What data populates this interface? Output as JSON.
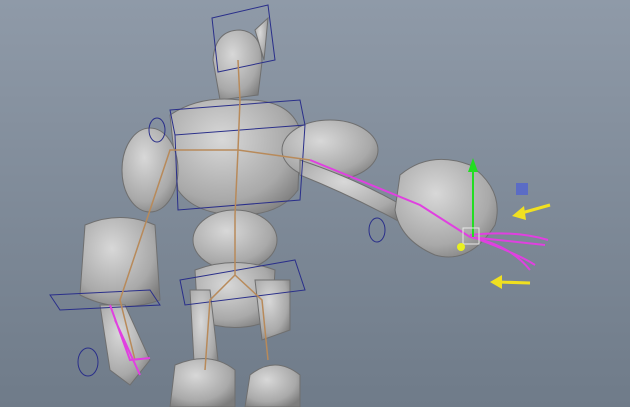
{
  "viewport": {
    "background_top": "#8f9aa8",
    "background_bottom": "#6f7b89",
    "mesh_color": "#c8c8c8",
    "mesh_shadow": "#8e8e8e",
    "control_box_color": "#2a2f8a",
    "ik_chain_color": "#e040e0",
    "joint_color": "#b88a5a",
    "arrow_color": "#f0e020",
    "manipulator_y_color": "#22dd22",
    "manipulator_handle_color": "#5566cc"
  },
  "icons": [
    "translate-manipulator-icon",
    "direction-arrow-icon"
  ]
}
